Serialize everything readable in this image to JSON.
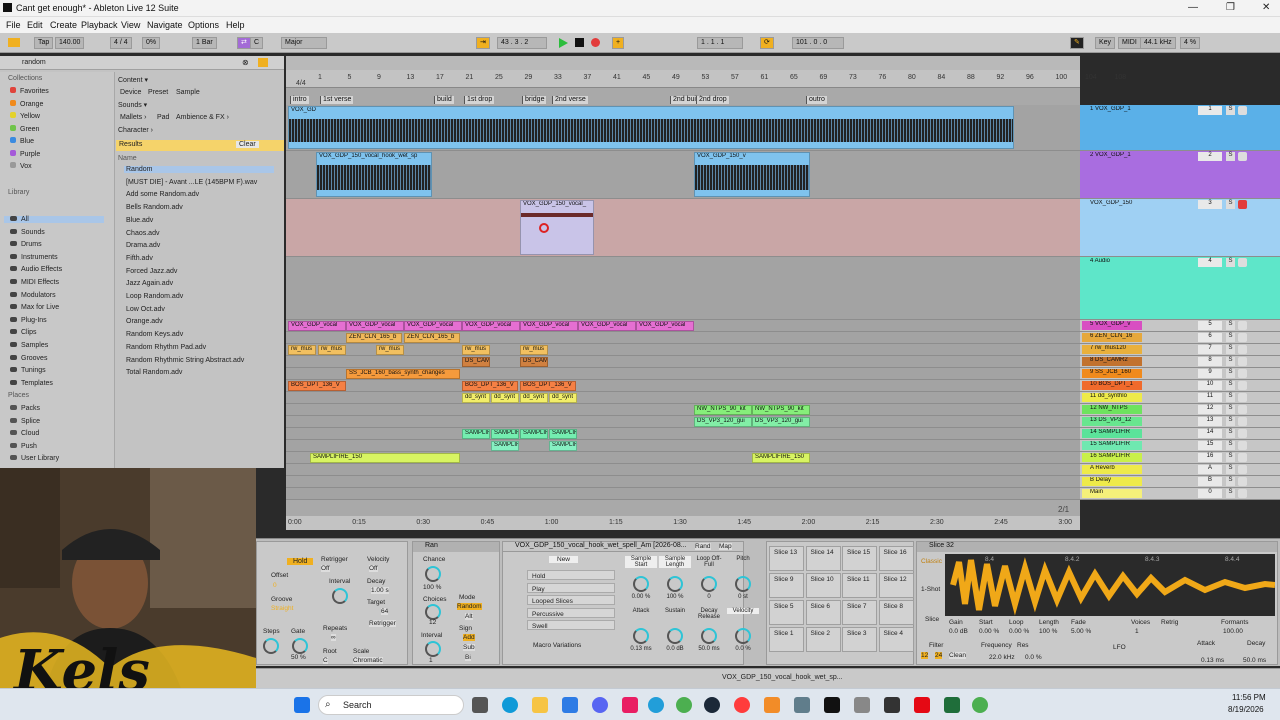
{
  "window": {
    "title": "Cant get enough* - Ableton Live 12 Suite",
    "minimize": "—",
    "restore": "❐",
    "close": "✕"
  },
  "menu": [
    "File",
    "Edit",
    "Create",
    "Playback",
    "View",
    "Navigate",
    "Options",
    "Help"
  ],
  "transport": {
    "tap": "Tap",
    "tempo": "140.00",
    "signature": "4 / 4",
    "groove": "0%",
    "quantize": "1 Bar",
    "key": "C",
    "scale": "Major",
    "position": "43 .  3 .  2",
    "loop_start": "1 .  1 .  1",
    "loop_length": "101 .  0 .  0",
    "key_label": "Key",
    "midi_label": "MIDI",
    "sample_rate": "44.1 kHz",
    "cpu": "4 %"
  },
  "browser": {
    "search": "random",
    "collections_title": "Collections",
    "collections": [
      {
        "label": "Favorites",
        "color": "#e0443c"
      },
      {
        "label": "Orange",
        "color": "#f08a1c"
      },
      {
        "label": "Yellow",
        "color": "#e3d22c"
      },
      {
        "label": "Green",
        "color": "#6fc44a"
      },
      {
        "label": "Blue",
        "color": "#3b8be0"
      },
      {
        "label": "Purple",
        "color": "#a55ad9"
      },
      {
        "label": "Vox",
        "color": "#999999"
      }
    ],
    "library_title": "Library",
    "library": [
      "All",
      "Sounds",
      "Drums",
      "Instruments",
      "Audio Effects",
      "MIDI Effects",
      "Modulators",
      "Max for Live",
      "Plug-Ins",
      "Clips",
      "Samples",
      "Grooves",
      "Tunings",
      "Templates"
    ],
    "places_title": "Places",
    "places": [
      "Packs",
      "Splice",
      "Cloud",
      "Push",
      "User Library"
    ],
    "content_label": "Content ▾",
    "filters": [
      "Device",
      "Preset",
      "Sample"
    ],
    "sounds_label": "Sounds ▾",
    "sound_tags": [
      "Mallets ›",
      "Pad",
      "Ambience & FX ›"
    ],
    "character_label": "Character ›",
    "results_label": "Results",
    "clear_label": "Clear",
    "name_header": "Name",
    "results": [
      "Random",
      "[MUST DIE] - Avant ...LE (145BPM F).wav",
      "Add some Random.adv",
      "Bells Random.adv",
      "Blue.adv",
      "Chaos.adv",
      "Drama.adv",
      "Fifth.adv",
      "Forced Jazz.adv",
      "Jazz Again.adv",
      "Loop Random.adv",
      "Low Oct.adv",
      "Orange.adv",
      "Random Keys.adv",
      "Random Rhythm Pad.adv",
      "Random Rhythmic String Abstract.adv",
      "Total Random.adv"
    ]
  },
  "ruler_bars": [
    "1",
    "5",
    "9",
    "13",
    "17",
    "21",
    "25",
    "29",
    "33",
    "37",
    "41",
    "45",
    "49",
    "53",
    "57",
    "61",
    "65",
    "69",
    "73",
    "76",
    "80",
    "84",
    "88",
    "92",
    "96",
    "100",
    "104",
    "108"
  ],
  "locators": [
    "intro",
    "1st verse",
    "build",
    "1st drop",
    "bridge",
    "2nd verse",
    "2nd build",
    "2nd drop",
    "outro"
  ],
  "time_ruler": [
    "0:00",
    "0:15",
    "0:30",
    "0:45",
    "1:00",
    "1:15",
    "1:30",
    "1:45",
    "2:00",
    "2:15",
    "2:30",
    "2:45",
    "3:00"
  ],
  "time_sig": "4/4",
  "page_count": "2/1",
  "tracks": [
    {
      "name": "1 VOX_GDP_1",
      "num": "1",
      "color": "#5ab0e8"
    },
    {
      "name": "2 VOX_GDP_1",
      "num": "2",
      "color": "#a96de0"
    },
    {
      "name": "VOX_GDP_150",
      "num": "3",
      "color": "#9fd0f3"
    },
    {
      "name": "4 Audio",
      "num": "4",
      "color": "#5ee6c9"
    },
    {
      "name": "5 VOX_GDP_v",
      "num": "5",
      "color": "#d84ec2"
    },
    {
      "name": "6 ZEN_CLN_16",
      "num": "6",
      "color": "#e6a83c"
    },
    {
      "name": "7 rw_mus120",
      "num": "7",
      "color": "#e9b03c"
    },
    {
      "name": "8 DS_CAMR2",
      "num": "8",
      "color": "#c2722e"
    },
    {
      "name": "9 SS_JCB_160",
      "num": "9",
      "color": "#f08a1c"
    },
    {
      "name": "10 BOS_DPT_1",
      "num": "10",
      "color": "#f06a2c"
    },
    {
      "name": "11 dd_synthlo",
      "num": "11",
      "color": "#eeea4a"
    },
    {
      "name": "12 NW_NTPS",
      "num": "12",
      "color": "#6ee35e"
    },
    {
      "name": "13 DS_VP3_12",
      "num": "13",
      "color": "#68e68f"
    },
    {
      "name": "14 SAMPLIFIR",
      "num": "14",
      "color": "#5be39a"
    },
    {
      "name": "15 SAMPLIFIR",
      "num": "15",
      "color": "#6fe8b0"
    },
    {
      "name": "16 SAMPLIFIR",
      "num": "16",
      "color": "#c9f04a"
    },
    {
      "name": "A Reverb",
      "num": "A",
      "color": "#eeea4a"
    },
    {
      "name": "B Delay",
      "num": "B",
      "color": "#eeea4a"
    },
    {
      "name": "Main",
      "num": "0",
      "color": "#f5f07a"
    }
  ],
  "clips": {
    "vox1": "VOX_GD",
    "vox2": "VOX_GDP_150_vocal_hook_wet_sp",
    "vox2b": "VOX_GDP_150_v",
    "vox3": "VOX_GDP_150_vocal_",
    "vox5": "VOX_GDP_vocal",
    "zen": "ZEN_CLN_165_b",
    "rw": "rw_mus",
    "ds": "DS_CAM",
    "ss": "SS_JCB_160_bass_synth_changes",
    "bos": "BOS_DPT_136_V",
    "dd": "dd_synt",
    "nw": "NW_NTPS_90_kit",
    "dsvp": "DS_VP3_120_gui",
    "samp": "SAMPLIF",
    "samp16": "SAMPLIFIRE_150"
  },
  "mixer": {
    "input1": "Ext. In",
    "allins": "All Ins",
    "allch": "All Channe",
    "in": "In",
    "auto": "Auto",
    "off": "Off",
    "main": "Main",
    "vol1": "-4.3",
    "vol2": "-4.5",
    "pan": "C",
    "inf": "-∞",
    "post": "Post",
    "s": "S",
    "half": "1/2",
    "vol_main": "-6.0",
    "zoom": "1.00x"
  },
  "devices": {
    "arp": {
      "hold": "Hold",
      "offset": "Offset",
      "offset_val": "0",
      "groove": "Groove",
      "groove_val": "Straight",
      "retrigger": "Retrigger",
      "retrigger_val": "Off",
      "velocity": "Velocity",
      "velocity_val": "Off",
      "interval": "Interval",
      "decay": "Decay",
      "decay_val": "1.00 s",
      "target": "Target",
      "target_val": "64",
      "repeats": "Repeats",
      "repeats_val": "∞",
      "steps": "Steps",
      "steps_val": "0",
      "gate": "Gate",
      "gate_val": "50 %",
      "root": "Root",
      "root_val": "C",
      "scale": "Scale",
      "scale_val": "Chromatic",
      "retrigger_btn": "Retrigger"
    },
    "random": {
      "title": "Ran",
      "chance": "Chance",
      "chance_val": "100 %",
      "choices": "Choices",
      "choices_val": "12",
      "interval": "Interval",
      "interval_val": "1",
      "mode": "Mode",
      "mode_val": "Random",
      "alt": "Alt",
      "sign": "Sign",
      "add": "Add",
      "sub": "Sub",
      "bi": "Bi"
    },
    "rack": {
      "title": "VOX_GDP_150_vocal_hook_wet_spell_Am [2026-08...",
      "rand": "Rand",
      "map": "Map",
      "new": "New",
      "variations": [
        "Hold",
        "Play",
        "Looped Slices",
        "Percussive",
        "Swell"
      ],
      "macro_variations": "Macro Variations",
      "macros": [
        {
          "label": "Sample Start",
          "value": "0.00 %"
        },
        {
          "label": "Sample Length",
          "value": "100 %"
        },
        {
          "label": "Loop Off-Full",
          "value": "0"
        },
        {
          "label": "Pitch",
          "value": "0 st"
        },
        {
          "label": "Attack",
          "value": "0.13 ms"
        },
        {
          "label": "Sustain",
          "value": "0.0 dB"
        },
        {
          "label": "Decay Release",
          "value": "50.0 ms"
        },
        {
          "label": "Velocity",
          "value": "0.0 %"
        }
      ]
    },
    "slices": [
      "Slice 13",
      "Slice 14",
      "Slice 15",
      "Slice 16",
      "Slice 9",
      "Slice 10",
      "Slice 11",
      "Slice 12",
      "Slice 5",
      "Slice 6",
      "Slice 7",
      "Slice 8",
      "Slice 1",
      "Slice 2",
      "Slice 3",
      "Slice 4"
    ],
    "simpler": {
      "title": "Slice 32",
      "classic": "Classic",
      "oneshot": "1-Shot",
      "slice": "Slice",
      "gain": "Gain",
      "gain_val": "0.0 dB",
      "start": "Start",
      "start_val": "0.00 %",
      "loop": "Loop",
      "loop_val": "0.00 %",
      "length": "Length",
      "length_val": "100 %",
      "fade": "Fade",
      "fade_val": "5.00 %",
      "voices": "Voices",
      "voices_val": "1",
      "retrig": "Retrig",
      "formants": "Formants",
      "formants_val": "100.00",
      "filter": "Filter",
      "freq": "Frequency",
      "freq_val": "22.0 kHz",
      "res": "Res",
      "res_val": "0.0 %",
      "lfo": "LFO",
      "attack": "Attack",
      "attack_val": "0.13 ms",
      "decay": "Decay",
      "decay_val": "50.0 ms",
      "filter_type": "12",
      "filter_mode": "24",
      "clean": "Clean",
      "markers": [
        "8.4",
        "8.4.2",
        "8.4.3",
        "8.4.4"
      ]
    }
  },
  "statusbar": {
    "clip": "VOX_GDP_150_vocal_hook_wet_sp..."
  },
  "taskbar": {
    "search": "Search",
    "time": "11:56 PM",
    "date": "8/19/2026"
  },
  "webcam": {
    "logo_text": "Kels"
  }
}
